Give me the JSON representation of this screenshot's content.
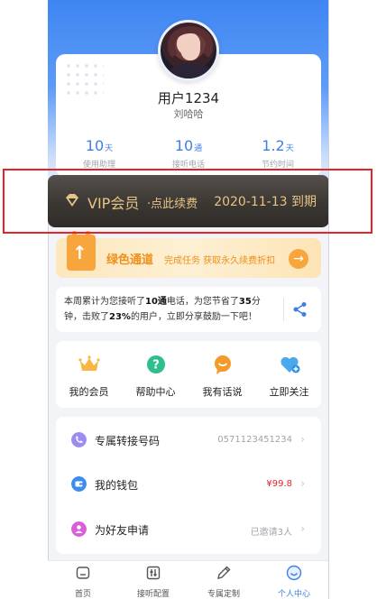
{
  "profile": {
    "username": "用户1234",
    "nickname": "刘哈哈",
    "stats": [
      {
        "value": "10",
        "unit": "天",
        "label": "使用助理"
      },
      {
        "value": "10",
        "unit": "通",
        "label": "接听电话"
      },
      {
        "value": "1.2",
        "unit": "天",
        "label": "节约时间"
      }
    ]
  },
  "vip": {
    "title": "VIP会员",
    "subtitle": "·点此续费",
    "expiry": "2020-11-13 到期",
    "gold_color": "#e7c486"
  },
  "green_channel": {
    "title": "绿色通道",
    "description": "完成任务 获取永久续费折扣",
    "accent_color": "#f08f19"
  },
  "weekly_summary": {
    "part1": "本周累计为您接听了",
    "calls": "10通",
    "part2": "电话，为您节省了",
    "minutes": "35",
    "part3": "分钟，击败了",
    "percent": "23%",
    "part4": "的用户，立即分享鼓励一下吧！",
    "share_icon": "share-icon"
  },
  "quick_actions": [
    {
      "label": "我的会员",
      "icon": "crown-icon"
    },
    {
      "label": "帮助中心",
      "icon": "help-icon"
    },
    {
      "label": "我有话说",
      "icon": "chat-icon"
    },
    {
      "label": "立即关注",
      "icon": "heart-plus-icon"
    }
  ],
  "list": [
    {
      "label": "专属转接号码",
      "value": "0571123451234",
      "icon": "phone-icon",
      "value_color": "#a0a4aa"
    },
    {
      "label": "我的钱包",
      "value": "¥99.8",
      "icon": "wallet-icon",
      "value_color": "#e4232b"
    },
    {
      "label": "为好友申请",
      "value": "已邀请3人",
      "icon": "friend-icon",
      "value_color": "#a0a4aa"
    }
  ],
  "tabs": [
    {
      "label": "首页",
      "icon": "home-icon",
      "active": false
    },
    {
      "label": "接听配置",
      "icon": "settings-sliders-icon",
      "active": false
    },
    {
      "label": "专属定制",
      "icon": "pencil-icon",
      "active": false
    },
    {
      "label": "个人中心",
      "icon": "profile-icon",
      "active": true
    }
  ]
}
